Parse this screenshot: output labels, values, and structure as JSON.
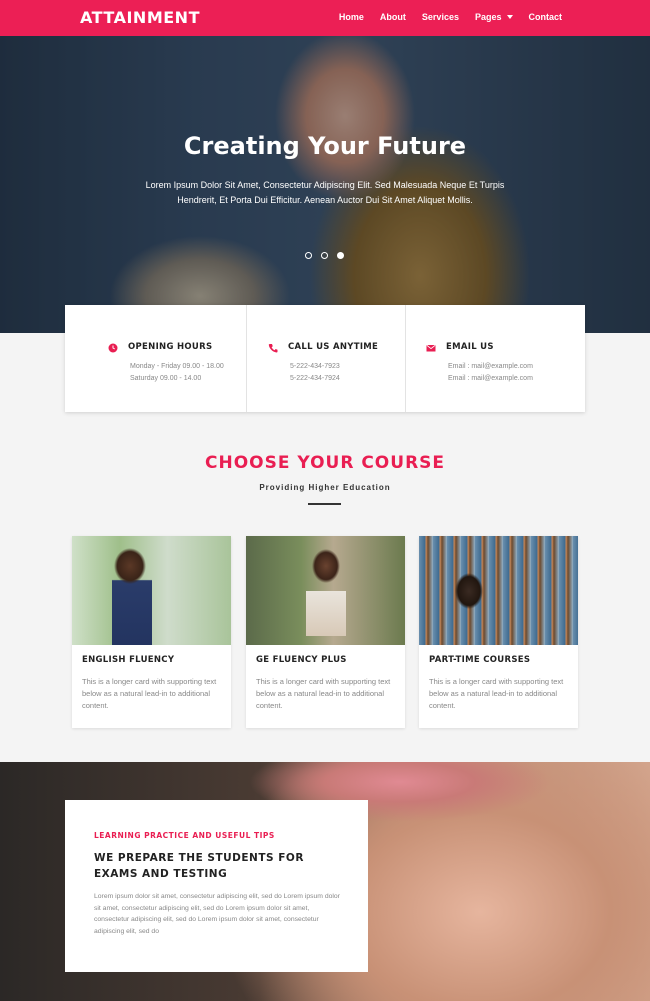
{
  "nav": {
    "brand": "ATTAINMENT",
    "items": [
      {
        "label": "Home"
      },
      {
        "label": "About"
      },
      {
        "label": "Services"
      },
      {
        "label": "Pages"
      },
      {
        "label": "Contact"
      }
    ]
  },
  "hero": {
    "title": "Creating Your Future",
    "text": "Lorem Ipsum Dolor Sit Amet, Consectetur Adipiscing Elit. Sed Malesuada Neque Et Turpis Hendrerit, Et Porta Dui Efficitur. Aenean Auctor Dui Sit Amet Aliquet Mollis.",
    "slide_count": 3,
    "active_slide": 3
  },
  "info": {
    "hours": {
      "title": "OPENING HOURS",
      "line1": "Monday - Friday 09.00 - 18.00",
      "line2": "Saturday 09.00 - 14.00"
    },
    "call": {
      "title": "CALL US ANYTIME",
      "line1": "5-222-434-7923",
      "line2": "5-222-434-7924"
    },
    "email": {
      "title": "EMAIL US",
      "line1": "Email : mail@example.com",
      "line2": "Email : mail@example.com"
    }
  },
  "courses": {
    "title": "CHOOSE YOUR COURSE",
    "subtitle": "Providing Higher Education",
    "cards": [
      {
        "title": "ENGLISH FLUENCY",
        "text": "This is a longer card with supporting text below as a natural lead-in to additional content."
      },
      {
        "title": "GE FLUENCY PLUS",
        "text": "This is a longer card with supporting text below as a natural lead-in to additional content."
      },
      {
        "title": "PART-TIME COURSES",
        "text": "This is a longer card with supporting text below as a natural lead-in to additional content."
      }
    ]
  },
  "tips": {
    "kicker": "LEARNING PRACTICE AND USEFUL TIPS",
    "heading": "WE PREPARE THE STUDENTS FOR EXAMS AND TESTING",
    "text": "Lorem ipsum dolor sit amet, consectetur adipiscing elit, sed do Lorem ipsum dolor sit amet, consectetur adipiscing elit, sed do Lorem ipsum dolor sit amet, consectetur adipiscing elit, sed do Lorem ipsum dolor sit amet, consectetur adipiscing elit, sed do"
  },
  "colors": {
    "accent": "#ec1f55",
    "text_dark": "#222222",
    "text_muted": "#888888"
  }
}
